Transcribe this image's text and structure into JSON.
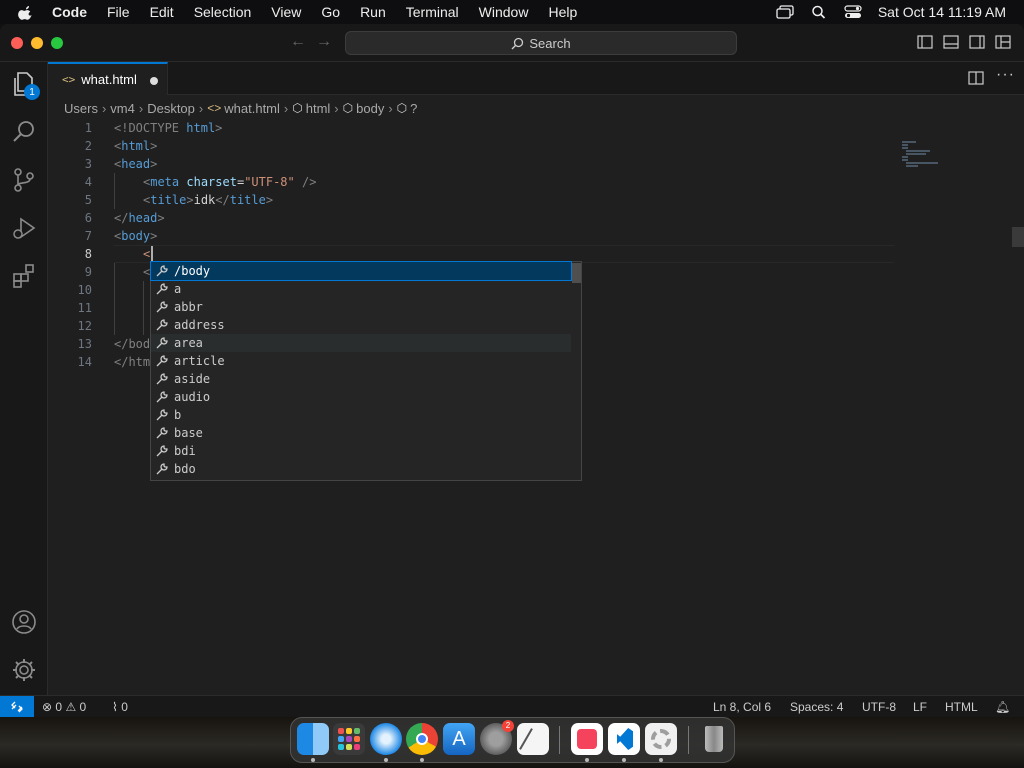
{
  "menubar": {
    "app": "Code",
    "items": [
      "File",
      "Edit",
      "Selection",
      "View",
      "Go",
      "Run",
      "Terminal",
      "Window",
      "Help"
    ],
    "clock": "Sat Oct 14  11:19 AM"
  },
  "titlebar": {
    "search_label": "Search"
  },
  "activity": {
    "explorer_badge": "1"
  },
  "tab": {
    "filename": "what.html",
    "icon": "<>"
  },
  "breadcrumb": {
    "parts": [
      "Users",
      "vm4",
      "Desktop",
      "what.html",
      "html",
      "body",
      "?"
    ]
  },
  "editor": {
    "line_numbers": [
      "1",
      "2",
      "3",
      "4",
      "5",
      "6",
      "7",
      "8",
      "9",
      "10",
      "11",
      "12",
      "13",
      "14"
    ],
    "active_line": "8",
    "lines": {
      "l1_doctype": "<!DOCTYPE",
      "l1_html": "html",
      "l1_close": ">",
      "l2": "html",
      "l3": "head",
      "l4_tag": "meta",
      "l4_attr": "charset",
      "l4_val": "\"UTF-8\"",
      "l4_end": " />",
      "l5_tag": "title",
      "l5_text": "idk",
      "l5_close": "title",
      "l6": "head",
      "l7": "body",
      "l8": "<",
      "l9": "<",
      "l13": "</bod",
      "l14": "</htm"
    }
  },
  "suggest": {
    "items": [
      "/body",
      "a",
      "abbr",
      "address",
      "area",
      "article",
      "aside",
      "audio",
      "b",
      "base",
      "bdi",
      "bdo"
    ],
    "selected": "/body",
    "icon": "wrench-icon"
  },
  "status": {
    "errors": "0",
    "warnings": "0",
    "ports": "0",
    "position": "Ln 8, Col 6",
    "spaces": "Spaces: 4",
    "encoding": "UTF-8",
    "eol": "LF",
    "language": "HTML"
  },
  "colors": {
    "accent": "#0078d4",
    "selection": "#04395e",
    "tag": "#569cd6",
    "attribute": "#9cdcfe",
    "string": "#ce9178"
  }
}
